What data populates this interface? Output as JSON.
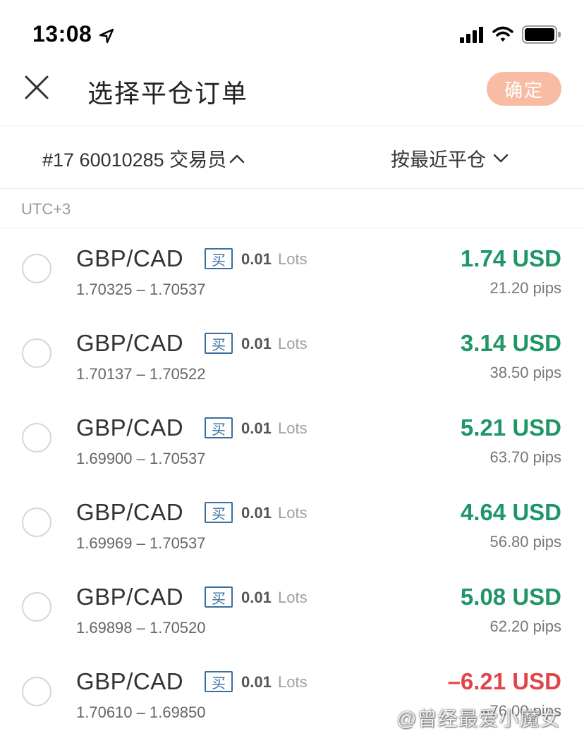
{
  "status_bar": {
    "time": "13:08",
    "icons": [
      "location-arrow-icon",
      "signal-icon",
      "wifi-icon",
      "battery-icon"
    ]
  },
  "header": {
    "close_icon": "close-icon",
    "title": "选择平仓订单",
    "confirm_label": "确定"
  },
  "filters": {
    "account": "#17 60010285 交易员",
    "sort": "按最近平仓"
  },
  "timezone": "UTC+3",
  "colors": {
    "accent": "#f8bba3",
    "profit_positive": "#1e9667",
    "profit_negative": "#e0454a",
    "badge": "#3a6f9e"
  },
  "orders": [
    {
      "symbol": "GBP/CAD",
      "side": "买",
      "lots": "0.01",
      "lots_unit": "Lots",
      "range": "1.70325 – 1.70537",
      "profit": "1.74 USD",
      "pips": "21.20 pips"
    },
    {
      "symbol": "GBP/CAD",
      "side": "买",
      "lots": "0.01",
      "lots_unit": "Lots",
      "range": "1.70137 – 1.70522",
      "profit": "3.14 USD",
      "pips": "38.50 pips"
    },
    {
      "symbol": "GBP/CAD",
      "side": "买",
      "lots": "0.01",
      "lots_unit": "Lots",
      "range": "1.69900 – 1.70537",
      "profit": "5.21 USD",
      "pips": "63.70 pips"
    },
    {
      "symbol": "GBP/CAD",
      "side": "买",
      "lots": "0.01",
      "lots_unit": "Lots",
      "range": "1.69969 – 1.70537",
      "profit": "4.64 USD",
      "pips": "56.80 pips"
    },
    {
      "symbol": "GBP/CAD",
      "side": "买",
      "lots": "0.01",
      "lots_unit": "Lots",
      "range": "1.69898 – 1.70520",
      "profit": "5.08 USD",
      "pips": "62.20 pips"
    },
    {
      "symbol": "GBP/CAD",
      "side": "买",
      "lots": "0.01",
      "lots_unit": "Lots",
      "range": "1.70610 – 1.69850",
      "profit": "–6.21 USD",
      "pips": "–76.00 pips"
    }
  ],
  "watermark": "@曾经最爱小魔女"
}
